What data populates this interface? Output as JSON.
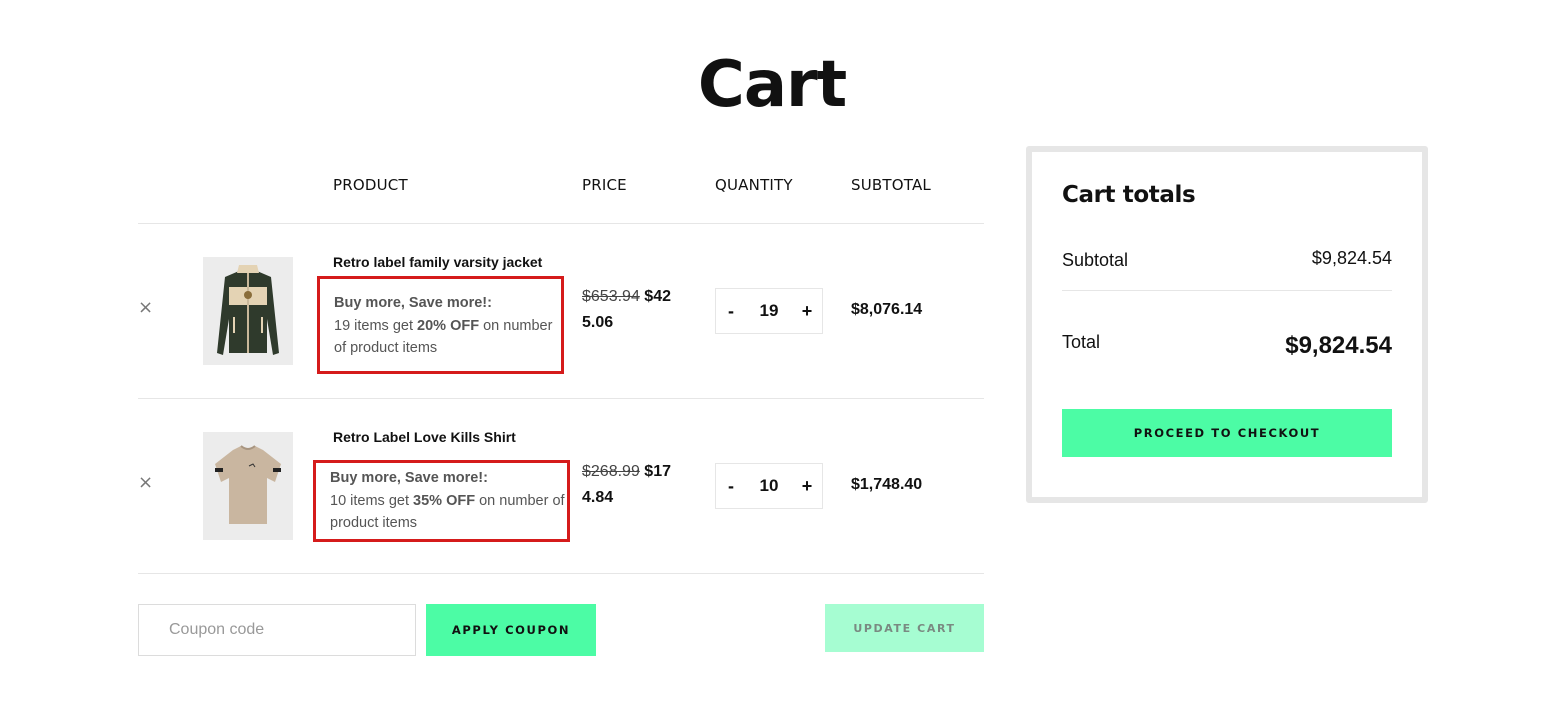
{
  "page": {
    "title": "Cart"
  },
  "table": {
    "headers": {
      "product": "PRODUCT",
      "price": "PRICE",
      "quantity": "QUANTITY",
      "subtotal": "SUBTOTAL"
    },
    "rows": [
      {
        "remove": "×",
        "name": "Retro label family varsity jacket",
        "promo_title": "Buy more, Save more!:",
        "promo_prefix": "19 items get",
        "promo_discount": "20% OFF",
        "promo_suffix": "on number of product items",
        "old_price": "$653.94",
        "new_price": "$425.06",
        "new_price_line1": "$42",
        "new_price_line2": "5.06",
        "qty_minus": "-",
        "qty": "19",
        "qty_plus": "+",
        "subtotal": "$8,076.14",
        "image_icon": "jacket-image"
      },
      {
        "remove": "×",
        "name": "Retro Label Love Kills Shirt",
        "promo_title": "Buy more, Save more!:",
        "promo_prefix": "10 items get",
        "promo_discount": "35% OFF",
        "promo_suffix": "on number of product items",
        "old_price": "$268.99",
        "new_price": "$174.84",
        "new_price_line1": "$17",
        "new_price_line2": "4.84",
        "qty_minus": "-",
        "qty": "10",
        "qty_plus": "+",
        "subtotal": "$1,748.40",
        "image_icon": "shirt-image"
      }
    ]
  },
  "actions": {
    "coupon_placeholder": "Coupon code",
    "apply_label": "APPLY COUPON",
    "update_label": "UPDATE CART"
  },
  "totals": {
    "title": "Cart totals",
    "subtotal_label": "Subtotal",
    "subtotal_value": "$9,824.54",
    "total_label": "Total",
    "total_value": "$9,824.54",
    "checkout_label": "PROCEED TO CHECKOUT"
  },
  "colors": {
    "accent": "#4cfca5",
    "accent_disabled": "#a6fdd2",
    "highlight_border": "#d51b1b"
  }
}
